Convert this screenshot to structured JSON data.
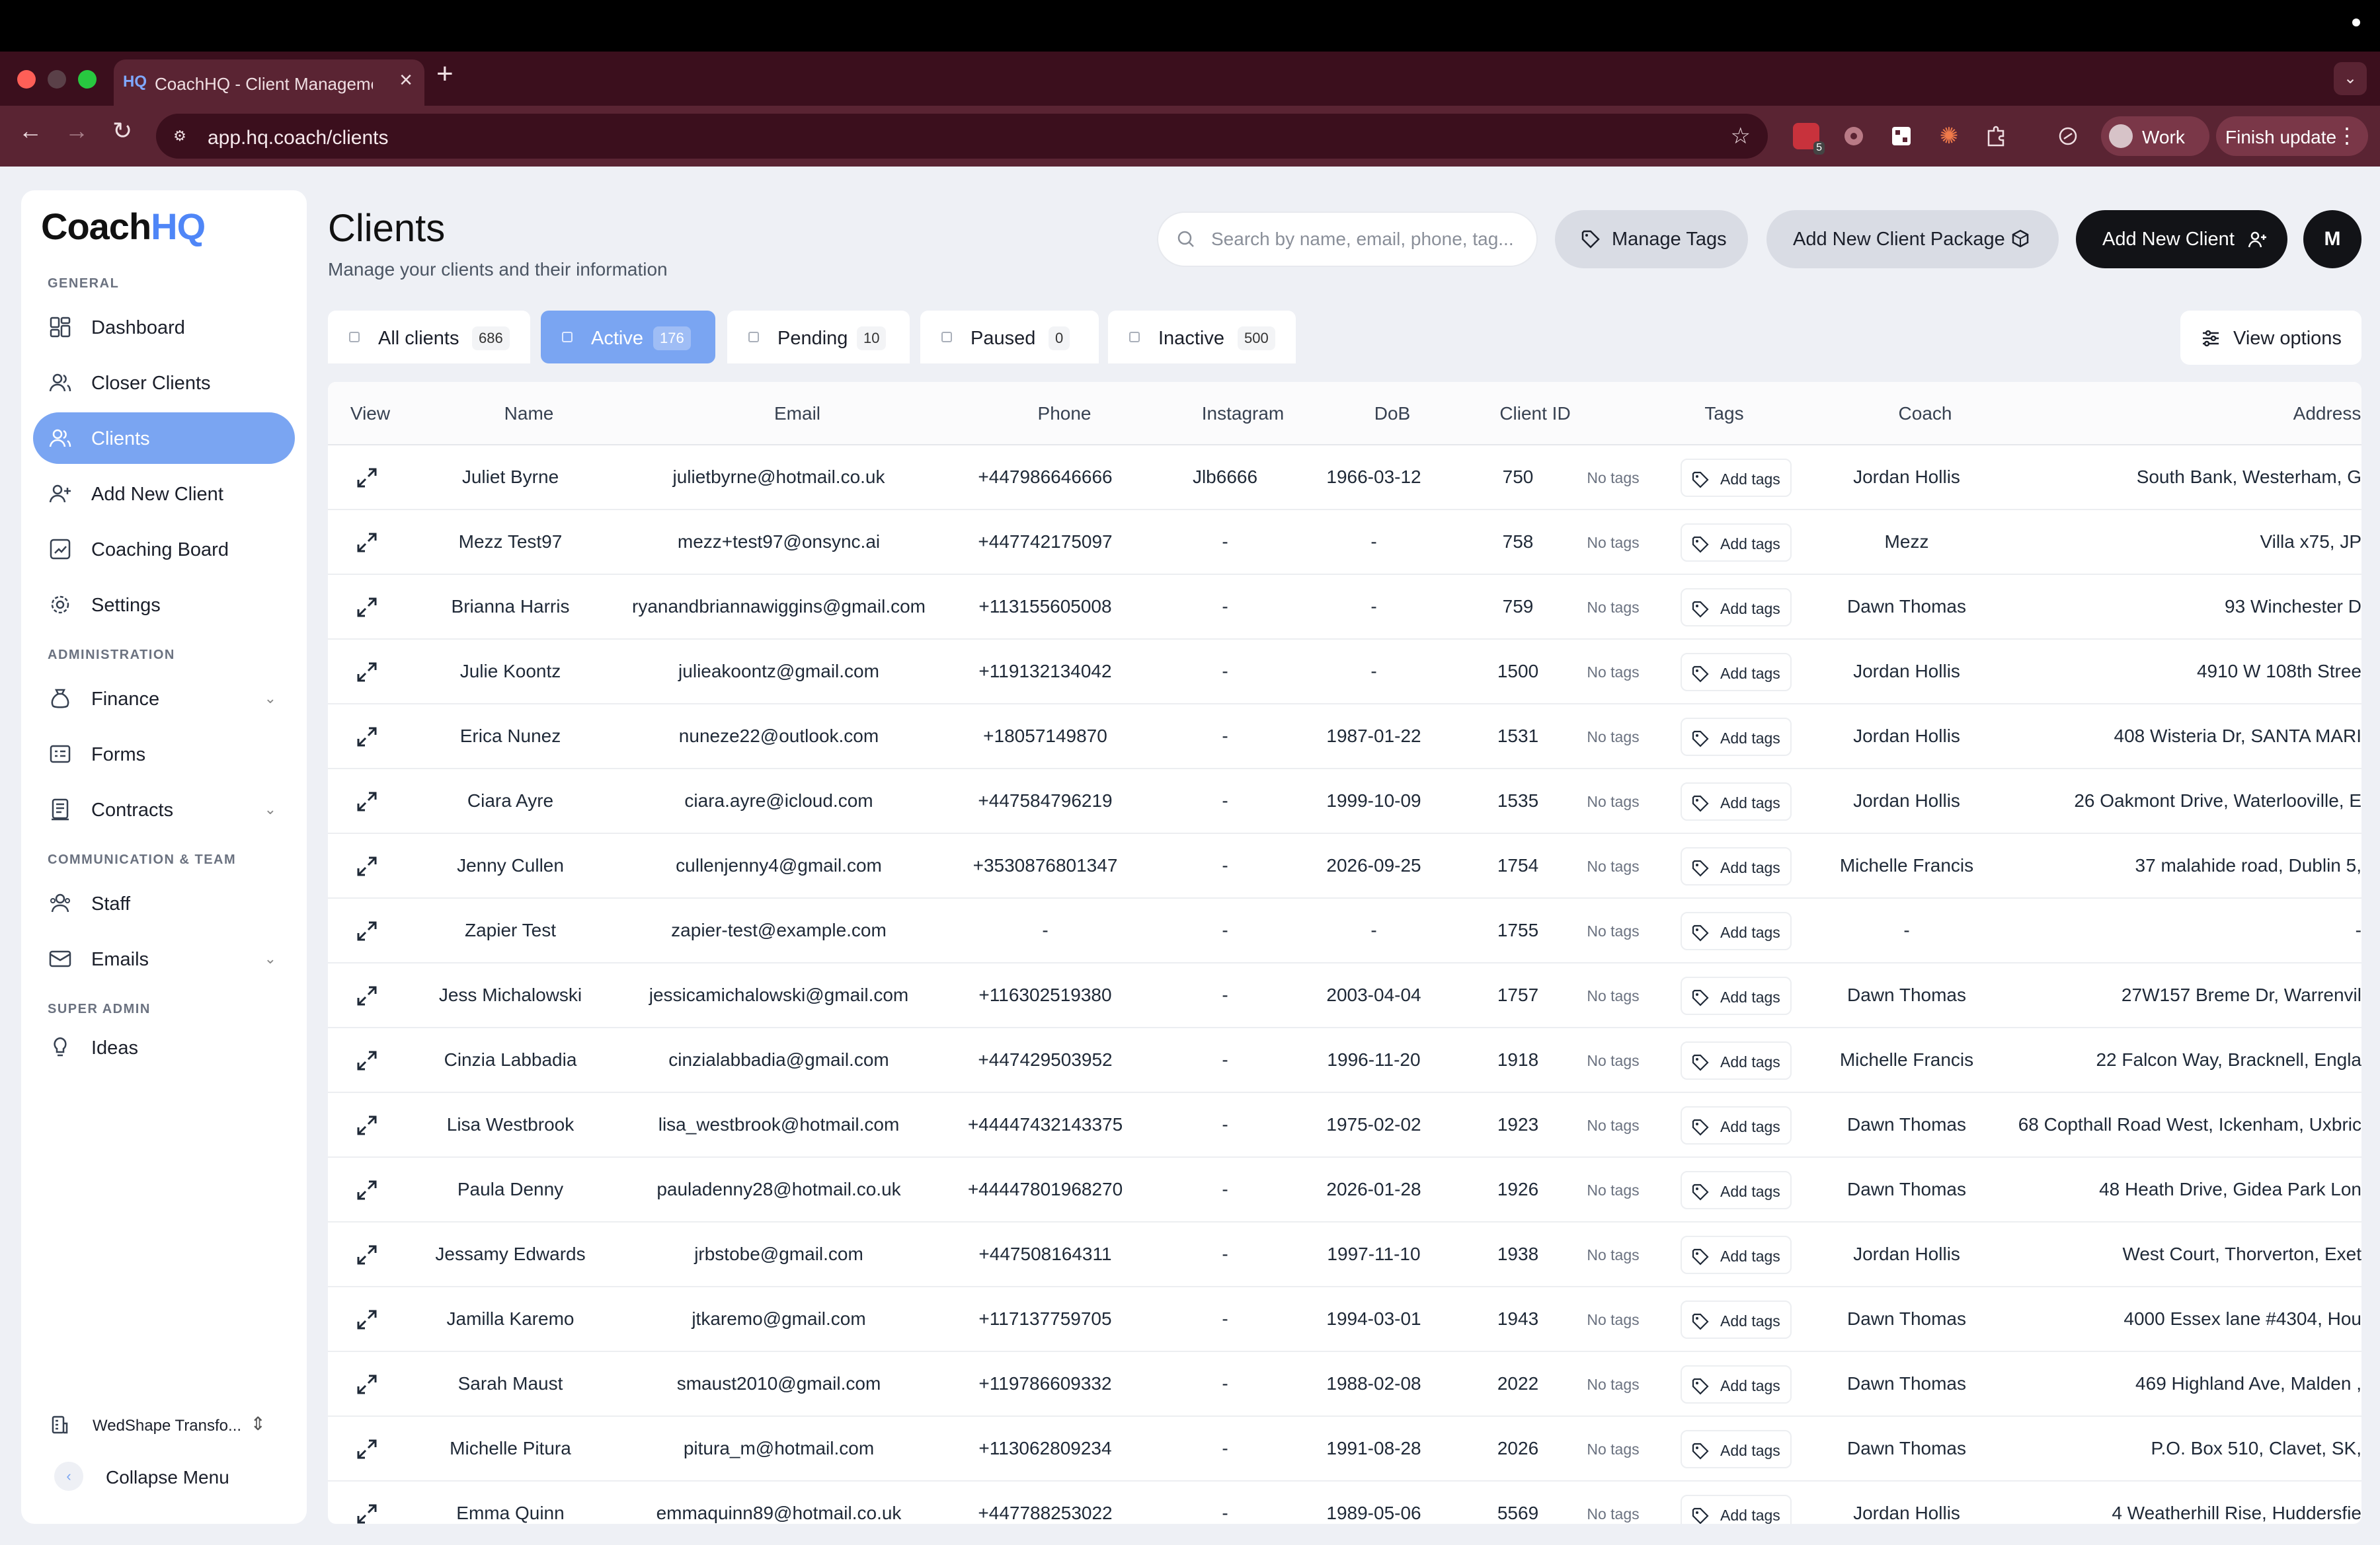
{
  "browser": {
    "tab_favicon": "HQ",
    "tab_title": "CoachHQ - Client Management",
    "url": "app.hq.coach/clients",
    "profile_label": "Work",
    "finish_update_label": "Finish update",
    "extension_badge": "5"
  },
  "sidebar": {
    "logo_part1": "Coach",
    "logo_part2": "HQ",
    "sections": {
      "general": "GENERAL",
      "administration": "ADMINISTRATION",
      "communication": "COMMUNICATION & TEAM",
      "super_admin": "SUPER ADMIN"
    },
    "items": [
      {
        "label": "Dashboard",
        "icon": "dashboard-icon"
      },
      {
        "label": "Closer Clients",
        "icon": "users-icon"
      },
      {
        "label": "Clients",
        "icon": "users-icon",
        "active": true
      },
      {
        "label": "Add New Client",
        "icon": "user-plus-icon"
      },
      {
        "label": "Coaching Board",
        "icon": "board-icon"
      },
      {
        "label": "Settings",
        "icon": "gear-icon"
      },
      {
        "label": "Finance",
        "icon": "money-bag-icon"
      },
      {
        "label": "Forms",
        "icon": "form-icon"
      },
      {
        "label": "Contracts",
        "icon": "contract-icon"
      },
      {
        "label": "Staff",
        "icon": "staff-icon"
      },
      {
        "label": "Emails",
        "icon": "mail-icon"
      },
      {
        "label": "Ideas",
        "icon": "lightbulb-icon"
      }
    ],
    "workspace": "WedShape Transfo...",
    "collapse_label": "Collapse Menu"
  },
  "header": {
    "title": "Clients",
    "subtitle": "Manage your clients and their information",
    "search_placeholder": "Search by name, email, phone, tag...",
    "manage_tags": "Manage Tags",
    "add_package": "Add New Client Package",
    "add_client": "Add New Client",
    "avatar_initial": "M"
  },
  "status_tabs": [
    {
      "label": "All clients",
      "count": "686"
    },
    {
      "label": "Active",
      "count": "176",
      "active": true
    },
    {
      "label": "Pending",
      "count": "10"
    },
    {
      "label": "Paused",
      "count": "0"
    },
    {
      "label": "Inactive",
      "count": "500"
    }
  ],
  "view_options": "View options",
  "table": {
    "columns": [
      "View",
      "Name",
      "Email",
      "Phone",
      "Instagram",
      "DoB",
      "Client ID",
      "Tags",
      "Coach",
      "Address"
    ],
    "no_tags_label": "No tags",
    "add_tags_label": "Add tags",
    "rows": [
      {
        "name": "Juliet Byrne",
        "email": "julietbyrne@hotmail.co.uk",
        "phone": "+447986646666",
        "instagram": "Jlb6666",
        "dob": "1966-03-12",
        "id": "750",
        "coach": "Jordan Hollis",
        "address": "South Bank, Westerham, G"
      },
      {
        "name": "Mezz Test97",
        "email": "mezz+test97@onsync.ai",
        "phone": "+447742175097",
        "instagram": "-",
        "dob": "-",
        "id": "758",
        "coach": "Mezz",
        "address": "Villa x75, JP"
      },
      {
        "name": "Brianna Harris",
        "email": "ryanandbriannawiggins@gmail.com",
        "phone": "+113155605008",
        "instagram": "-",
        "dob": "-",
        "id": "759",
        "coach": "Dawn Thomas",
        "address": "93 Winchester D"
      },
      {
        "name": "Julie Koontz",
        "email": "julieakoontz@gmail.com",
        "phone": "+119132134042",
        "instagram": "-",
        "dob": "-",
        "id": "1500",
        "coach": "Jordan Hollis",
        "address": "4910 W 108th Stree"
      },
      {
        "name": "Erica Nunez",
        "email": "nuneze22@outlook.com",
        "phone": "+18057149870",
        "instagram": "-",
        "dob": "1987-01-22",
        "id": "1531",
        "coach": "Jordan Hollis",
        "address": "408 Wisteria Dr, SANTA MARI"
      },
      {
        "name": "Ciara Ayre",
        "email": "ciara.ayre@icloud.com",
        "phone": "+447584796219",
        "instagram": "-",
        "dob": "1999-10-09",
        "id": "1535",
        "coach": "Jordan Hollis",
        "address": "26 Oakmont Drive, Waterlooville, E"
      },
      {
        "name": "Jenny Cullen",
        "email": "cullenjenny4@gmail.com",
        "phone": "+3530876801347",
        "instagram": "-",
        "dob": "2026-09-25",
        "id": "1754",
        "coach": "Michelle Francis",
        "address": "37 malahide road, Dublin 5,"
      },
      {
        "name": "Zapier Test",
        "email": "zapier-test@example.com",
        "phone": "-",
        "instagram": "-",
        "dob": "-",
        "id": "1755",
        "coach": "-",
        "address": "-"
      },
      {
        "name": "Jess Michalowski",
        "email": "jessicamichalowski@gmail.com",
        "phone": "+116302519380",
        "instagram": "-",
        "dob": "2003-04-04",
        "id": "1757",
        "coach": "Dawn Thomas",
        "address": "27W157 Breme Dr, Warrenvil"
      },
      {
        "name": "Cinzia Labbadia",
        "email": "cinzialabbadia@gmail.com",
        "phone": "+447429503952",
        "instagram": "-",
        "dob": "1996-11-20",
        "id": "1918",
        "coach": "Michelle Francis",
        "address": "22 Falcon Way, Bracknell, Engla"
      },
      {
        "name": "Lisa Westbrook",
        "email": "lisa_westbrook@hotmail.com",
        "phone": "+44447432143375",
        "instagram": "-",
        "dob": "1975-02-02",
        "id": "1923",
        "coach": "Dawn Thomas",
        "address": "68 Copthall Road West, Ickenham, Uxbric"
      },
      {
        "name": "Paula Denny",
        "email": "pauladenny28@hotmail.co.uk",
        "phone": "+44447801968270",
        "instagram": "-",
        "dob": "2026-01-28",
        "id": "1926",
        "coach": "Dawn Thomas",
        "address": "48 Heath Drive, Gidea Park Lon"
      },
      {
        "name": "Jessamy Edwards",
        "email": "jrbstobe@gmail.com",
        "phone": "+447508164311",
        "instagram": "-",
        "dob": "1997-11-10",
        "id": "1938",
        "coach": "Jordan Hollis",
        "address": "West Court, Thorverton, Exet"
      },
      {
        "name": "Jamilla Karemo",
        "email": "jtkaremo@gmail.com",
        "phone": "+117137759705",
        "instagram": "-",
        "dob": "1994-03-01",
        "id": "1943",
        "coach": "Dawn Thomas",
        "address": "4000 Essex lane #4304, Hou"
      },
      {
        "name": "Sarah Maust",
        "email": "smaust2010@gmail.com",
        "phone": "+119786609332",
        "instagram": "-",
        "dob": "1988-02-08",
        "id": "2022",
        "coach": "Dawn Thomas",
        "address": "469 Highland Ave, Malden ,"
      },
      {
        "name": "Michelle Pitura",
        "email": "pitura_m@hotmail.com",
        "phone": "+113062809234",
        "instagram": "-",
        "dob": "1991-08-28",
        "id": "2026",
        "coach": "Dawn Thomas",
        "address": "P.O. Box 510, Clavet, SK,"
      },
      {
        "name": "Emma Quinn",
        "email": "emmaquinn89@hotmail.co.uk",
        "phone": "+447788253022",
        "instagram": "-",
        "dob": "1989-05-06",
        "id": "5569",
        "coach": "Jordan Hollis",
        "address": "4 Weatherhill Rise, Huddersfie"
      }
    ]
  },
  "colors": {
    "accent": "#7aa5f2",
    "brand_blue": "#4f86f7",
    "browser_chrome": "#5a2433",
    "dark_button": "#121317"
  }
}
